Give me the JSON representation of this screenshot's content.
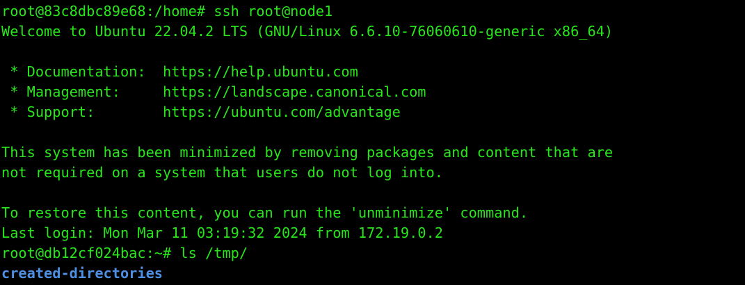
{
  "terminal": {
    "lines": [
      "root@83c8dbc89e68:/home# ssh root@node1",
      "Welcome to Ubuntu 22.04.2 LTS (GNU/Linux 6.6.10-76060610-generic x86_64)",
      "",
      " * Documentation:  https://help.ubuntu.com",
      " * Management:     https://landscape.canonical.com",
      " * Support:        https://ubuntu.com/advantage",
      "",
      "This system has been minimized by removing packages and content that are",
      "not required on a system that users do not log into.",
      "",
      "To restore this content, you can run the 'unminimize' command.",
      "Last login: Mon Mar 11 03:19:32 2024 from 172.19.0.2",
      "root@db12cf024bac:~# ls /tmp/"
    ],
    "ls_output": [
      "created-directories"
    ],
    "colors": {
      "background": "#000000",
      "text": "#29e51c",
      "directory": "#4f8fe2"
    }
  }
}
